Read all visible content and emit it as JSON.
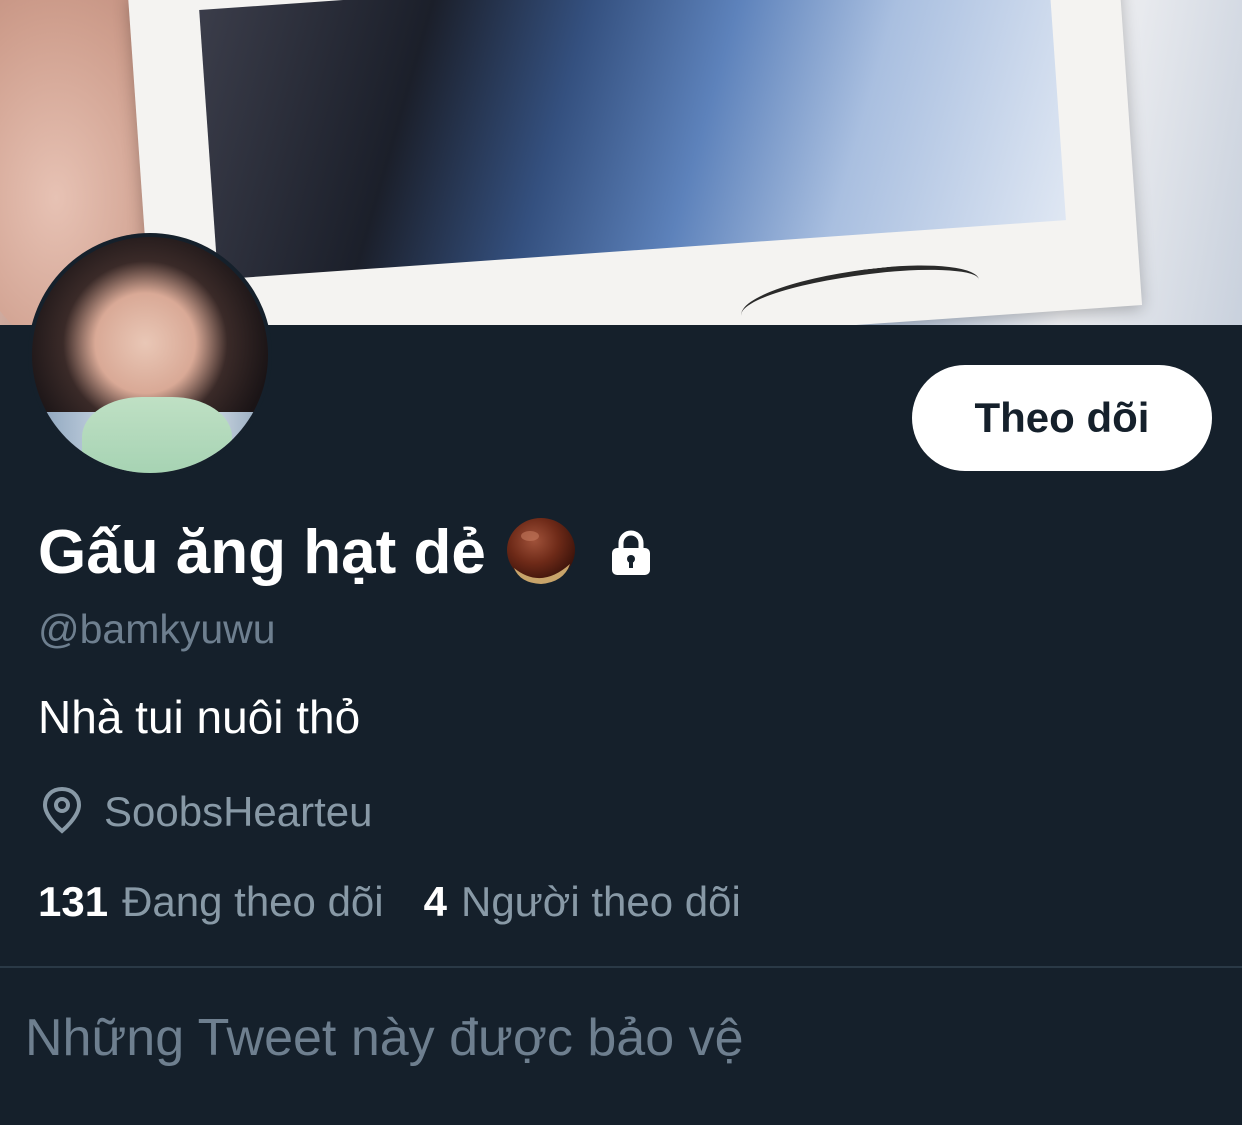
{
  "profile": {
    "display_name": "Gấu ăng hạt dẻ",
    "handle": "@bamkyuwu",
    "bio": "Nhà tui nuôi thỏ",
    "location": "SoobsHearteu",
    "follow_button_label": "Theo dõi",
    "following_count": "131",
    "following_label": "Đang theo dõi",
    "followers_count": "4",
    "followers_label": "Người theo dõi",
    "protected_notice": "Những Tweet này được bảo vệ",
    "name_emoji_icon": "chestnut-icon",
    "protected_icon": "lock-icon",
    "location_icon": "location-pin-icon"
  },
  "colors": {
    "background": "#15202b",
    "primary_text": "#ffffff",
    "secondary_text": "#8899a6",
    "button_bg": "#ffffff",
    "button_text": "#15202b"
  }
}
